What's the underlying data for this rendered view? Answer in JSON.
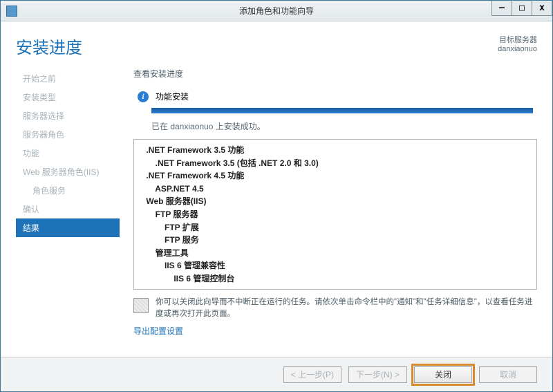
{
  "window": {
    "title": "添加角色和功能向导",
    "min": "—",
    "max": "□",
    "close": "x"
  },
  "header": {
    "page_title": "安装进度",
    "target_label": "目标服务器",
    "target_name": "danxiaonuo"
  },
  "sidebar": {
    "items": [
      {
        "label": "开始之前"
      },
      {
        "label": "安装类型"
      },
      {
        "label": "服务器选择"
      },
      {
        "label": "服务器角色"
      },
      {
        "label": "功能"
      },
      {
        "label": "Web 服务器角色(IIS)"
      },
      {
        "label": "角色服务"
      },
      {
        "label": "确认"
      },
      {
        "label": "结果"
      }
    ]
  },
  "main": {
    "section_label": "查看安装进度",
    "status_text": "功能安装",
    "done_msg": "已在 danxiaonuo 上安装成功。",
    "feature_tree": [
      {
        "t": ".NET Framework 3.5 功能",
        "d": 0,
        "b": true
      },
      {
        "t": ".NET Framework 3.5 (包括 .NET 2.0 和 3.0)",
        "d": 1,
        "b": true
      },
      {
        "t": ".NET Framework 4.5 功能",
        "d": 0,
        "b": true
      },
      {
        "t": "ASP.NET 4.5",
        "d": 1,
        "b": true
      },
      {
        "t": "Web 服务器(IIS)",
        "d": 0,
        "b": true
      },
      {
        "t": "FTP 服务器",
        "d": 1,
        "b": true
      },
      {
        "t": "FTP 扩展",
        "d": 2,
        "b": true
      },
      {
        "t": "FTP 服务",
        "d": 2,
        "b": true
      },
      {
        "t": "管理工具",
        "d": 1,
        "b": true
      },
      {
        "t": "IIS 6 管理兼容性",
        "d": 2,
        "b": true
      },
      {
        "t": "IIS 6 管理控制台",
        "d": 3,
        "b": true
      }
    ],
    "note_text": "你可以关闭此向导而不中断正在运行的任务。请依次单击命令栏中的\"通知\"和\"任务详细信息\"，以查看任务进度或再次打开此页面。",
    "export_link": "导出配置设置"
  },
  "footer": {
    "prev": "< 上一步(P)",
    "next": "下一步(N) >",
    "close": "关闭",
    "cancel": "取消"
  }
}
